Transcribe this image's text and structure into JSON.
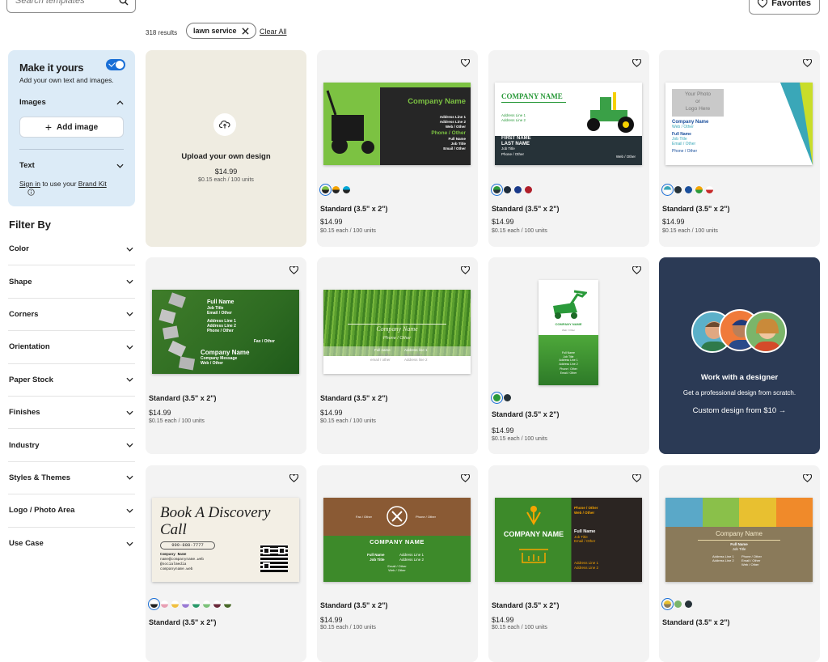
{
  "search": {
    "placeholder": "Search templates"
  },
  "favorites_label": "Favorites",
  "results_count": "318 results",
  "filter_chip": "lawn service",
  "clear_all": "Clear All",
  "panel": {
    "title": "Make it yours",
    "subtitle": "Add your own text and images.",
    "images_label": "Images",
    "add_image": "Add image",
    "text_label": "Text",
    "sign_in": "Sign in",
    "sign_mid": " to use your ",
    "brand_kit": "Brand Kit"
  },
  "filter_by": "Filter By",
  "filters": [
    "Color",
    "Shape",
    "Corners",
    "Orientation",
    "Paper Stock",
    "Finishes",
    "Industry",
    "Styles & Themes",
    "Logo / Photo Area",
    "Use Case"
  ],
  "upload": {
    "title": "Upload your own design",
    "price": "$14.99",
    "unit": "$0.15 each / 100 units"
  },
  "designer": {
    "title": "Work with a designer",
    "subtitle": "Get a professional design from scratch.",
    "cta": "Custom design from $10 →"
  },
  "product": {
    "title": "Standard (3.5\" x 2\")",
    "price": "$14.99",
    "unit": "$0.15 each / 100 units"
  },
  "cards": [
    {
      "company": "Company Name",
      "lines": [
        "Address Line 1",
        "Address Line 2",
        "Web / Other",
        "Phone / Other",
        "Full Name",
        "Job Title",
        "Email / Other"
      ]
    },
    {
      "company": "COMPANY NAME",
      "lines": [
        "Address Line 1",
        "Address Line 2",
        "FIRST NAME",
        "LAST NAME",
        "Job Title",
        "Phone / Other",
        "Web / Other"
      ]
    },
    {
      "company": "Company Name",
      "lines": [
        "Your Photo",
        "or",
        "Logo Here",
        "Web / Other",
        "Full Name",
        "Job Title",
        "Email / Other",
        "Phone / Other"
      ]
    },
    {
      "company": "Company Name",
      "lines": [
        "Full Name",
        "Job Title",
        "Email / Other",
        "Address Line 1",
        "Address Line 2",
        "Phone / Other",
        "Fax / Other",
        "Company Message",
        "Web / Other"
      ]
    },
    {
      "company": "Company Name",
      "lines": [
        "Phone / Other",
        "Full name",
        "Job title",
        "email / other",
        "Address line 1",
        "web / other",
        "Address line 2"
      ]
    },
    {
      "company": "COMPANY NAME",
      "lines": [
        "Web / Other",
        "Full Name",
        "Job Title",
        "Address Line 1",
        "Address Line 2",
        "Phone / Other",
        "Email / Other"
      ]
    },
    {
      "company": "Book A Discovery Call",
      "lines": [
        "999-888-7777",
        "Company Name",
        "name@companyname.web",
        "@socialmedia",
        "companyname.web"
      ]
    },
    {
      "company": "COMPANY NAME",
      "lines": [
        "Fax / Other",
        "Phone / Other",
        "Full Name",
        "Job Title",
        "Address Line 1",
        "Address Line 2",
        "Email / Other",
        "Web / Other"
      ]
    },
    {
      "company": "COMPANY NAME",
      "lines": [
        "Phone / Other",
        "Web / Other",
        "Full Name",
        "Job Title",
        "Email / Other",
        "Address Line 1",
        "Address Line 2"
      ]
    },
    {
      "company": "Company Name",
      "lines": [
        "Full Name",
        "Job Title",
        "Address Line 1",
        "Address Line 2",
        "Phone / Other",
        "Email / Other",
        "Web / Other"
      ]
    }
  ],
  "colors": {
    "accent": "#1a6fd6",
    "panel_bg": "#dcebf7",
    "designer_bg": "#2b3a55"
  }
}
